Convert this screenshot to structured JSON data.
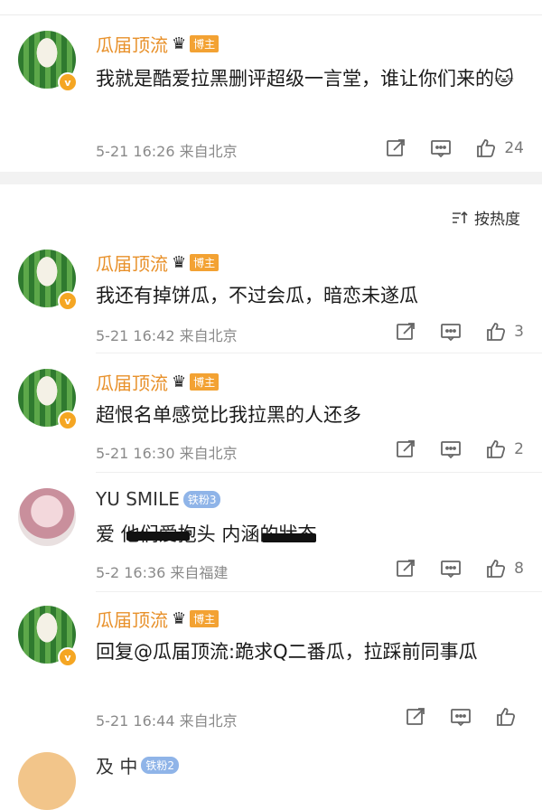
{
  "sort_label": "按热度",
  "pinned": {
    "user": "瓜届顶流",
    "badge": "博主",
    "text": "我就是酷爱拉黑删评超级一言堂，谁让你们来的",
    "emoji": "🐱",
    "time": "5-21 16:26",
    "location": "来自北京",
    "likes": "24"
  },
  "comments": [
    {
      "user": "瓜届顶流",
      "badge": "博主",
      "text": "我还有掉饼瓜，不过会瓜，暗恋未遂瓜",
      "time": "5-21 16:42",
      "location": "来自北京",
      "likes": "3"
    },
    {
      "user": "瓜届顶流",
      "badge": "博主",
      "text": "超恨名单感觉比我拉黑的人还多",
      "time": "5-21 16:30",
      "location": "来自北京",
      "likes": "2"
    },
    {
      "user": "YU SMILE",
      "badge": "铁粉3",
      "text": "爱 他们爱抱头 内涵的狀态",
      "time": "5-2 16:36",
      "location": "来自福建",
      "likes": "8"
    },
    {
      "user": "瓜届顶流",
      "badge": "博主",
      "text": "回复@瓜届顶流:跪求Q二番瓜，拉踩前同事瓜",
      "time": "5-21 16:44",
      "location": "来自北京",
      "likes": ""
    },
    {
      "user": "及 中",
      "badge": "铁粉2"
    }
  ]
}
